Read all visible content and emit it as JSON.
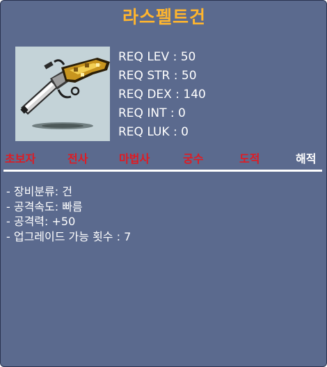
{
  "item": {
    "name": "라스펠트건",
    "icon": "flintlock-pistol-icon"
  },
  "requirements": [
    {
      "label": "REQ LEV",
      "value": "50"
    },
    {
      "label": "REQ STR",
      "value": "50"
    },
    {
      "label": "REQ DEX",
      "value": "140"
    },
    {
      "label": "REQ INT",
      "value": "0"
    },
    {
      "label": "REQ LUK",
      "value": "0"
    }
  ],
  "jobs": [
    {
      "label": "초보자",
      "eligible": false
    },
    {
      "label": "전사",
      "eligible": false
    },
    {
      "label": "마법사",
      "eligible": false
    },
    {
      "label": "궁수",
      "eligible": false
    },
    {
      "label": "도적",
      "eligible": false
    },
    {
      "label": "해적",
      "eligible": true
    }
  ],
  "stats": [
    "- 장비분류: 건",
    "- 공격속도: 빠름",
    "- 공격력: +50",
    "- 업그레이드 가능 횟수 : 7"
  ],
  "colors": {
    "background": "#5b6a8e",
    "name": "#ffb52e",
    "text": "#ffffff",
    "job_ineligible": "#e11a22",
    "job_eligible": "#ffffff"
  }
}
